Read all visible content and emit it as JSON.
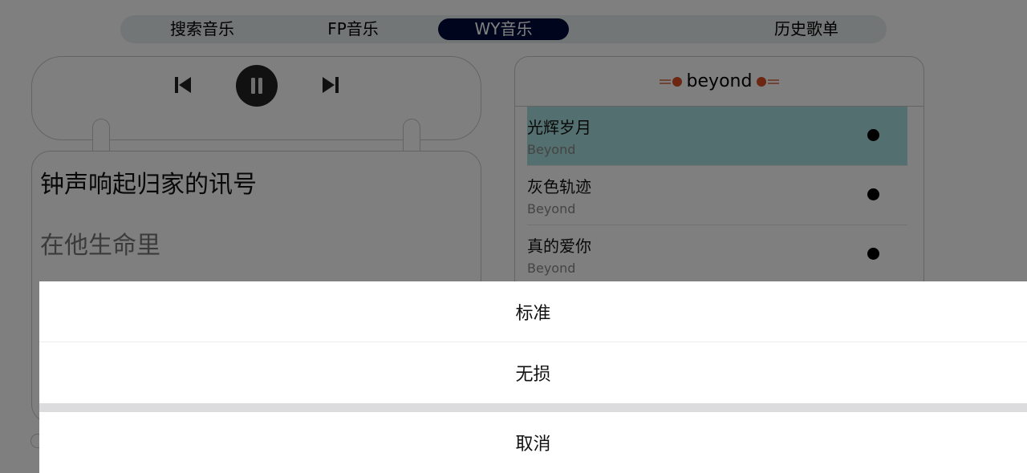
{
  "tabs": [
    {
      "label": "搜索音乐",
      "active": false
    },
    {
      "label": "FP音乐",
      "active": false
    },
    {
      "label": "WY音乐",
      "active": true
    },
    {
      "label": "历史歌单",
      "active": false
    }
  ],
  "player": {
    "controls": [
      "prev-icon",
      "pause-icon",
      "next-icon"
    ]
  },
  "lyrics": {
    "current_line": "钟声响起归家的讯号",
    "next_line": "在他生命里"
  },
  "playlist": {
    "title": "beyond",
    "songs": [
      {
        "title": "光辉岁月",
        "artist": "Beyond",
        "current": true
      },
      {
        "title": "灰色轨迹",
        "artist": "Beyond",
        "current": false
      },
      {
        "title": "真的爱你",
        "artist": "Beyond",
        "current": false
      }
    ]
  },
  "action_sheet": {
    "options": [
      "标准",
      "无损"
    ],
    "cancel": "取消"
  },
  "colors": {
    "active_tab": "#000a3c",
    "current_song_bg": "#a8dede",
    "scrim": "rgba(0,0,0,0.5)"
  }
}
